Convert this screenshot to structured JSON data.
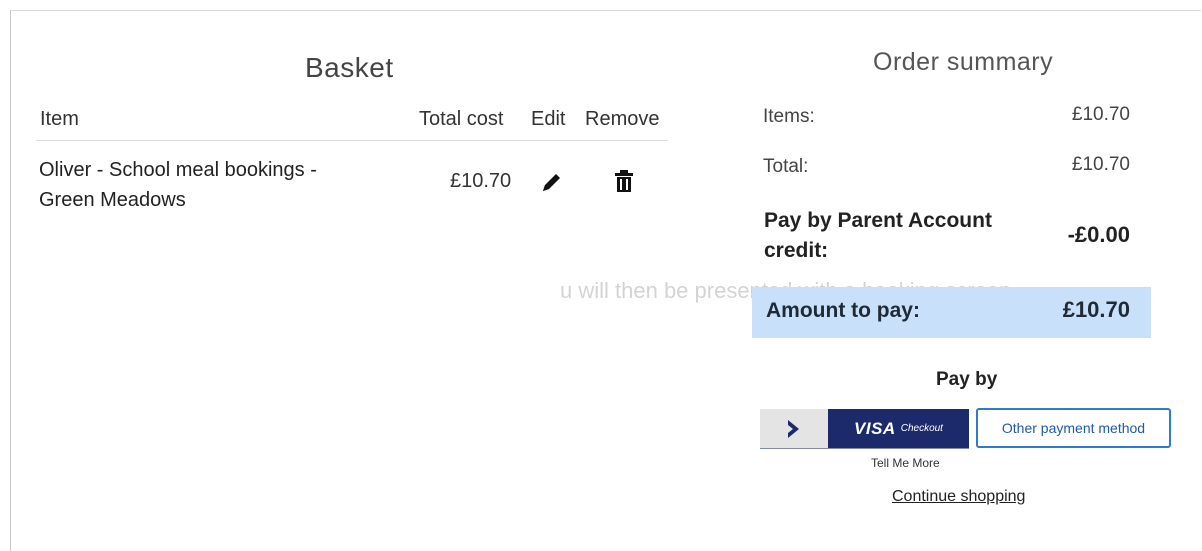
{
  "basket": {
    "title": "Basket",
    "columns": {
      "item": "Item",
      "total_cost": "Total cost",
      "edit": "Edit",
      "remove": "Remove"
    },
    "rows": [
      {
        "item_name_line1": "Oliver - School meal bookings -",
        "item_name_line2": "Green Meadows",
        "total_cost": "£10.70",
        "edit_icon": "pencil-icon",
        "remove_icon": "trash-icon"
      }
    ]
  },
  "summary": {
    "title": "Order summary",
    "items_label": "Items:",
    "items_value": "£10.70",
    "total_label": "Total:",
    "total_value": "£10.70",
    "credit_label": "Pay by Parent Account credit:",
    "credit_value": "-£0.00",
    "amount_label": "Amount to pay:",
    "amount_value": "£10.70",
    "highlight_color": "#c9e0fa"
  },
  "payment": {
    "pay_by_label": "Pay by",
    "visa_brand": "VISA",
    "visa_sub": "Checkout",
    "tell_me_more": "Tell Me More",
    "other_method": "Other payment method",
    "continue_shopping": "Continue shopping"
  },
  "colors": {
    "accent_blue": "#2d7bd1",
    "visa_navy": "#1c2a6b"
  }
}
